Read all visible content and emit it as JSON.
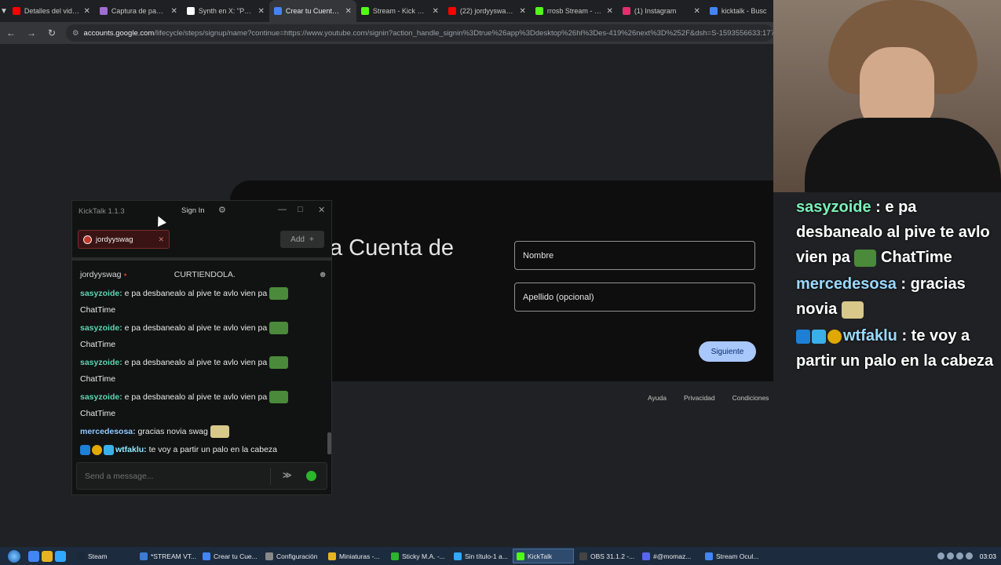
{
  "browser": {
    "tabs": [
      {
        "label": "Detalles del video",
        "color": "#ff0000",
        "active": false
      },
      {
        "label": "Captura de pantalla",
        "color": "#a06cd5",
        "active": false
      },
      {
        "label": "Synth en X: \"Podría",
        "color": "#ffffff",
        "active": false
      },
      {
        "label": "Crear tu Cuenta de",
        "color": "#4285f4",
        "active": true
      },
      {
        "label": "Stream - Kick Dash",
        "color": "#53fc18",
        "active": false
      },
      {
        "label": "(22) jordyyswag X",
        "color": "#ff0000",
        "active": false
      },
      {
        "label": "rrosb Stream - Wa",
        "color": "#53fc18",
        "active": false
      },
      {
        "label": "(1) Instagram",
        "color": "#e1306c",
        "active": false
      },
      {
        "label": "kicktalk - Busc",
        "color": "#4285f4",
        "active": false
      }
    ],
    "url_host": "accounts.google.com",
    "url_path": "/lifecycle/steps/signup/name?continue=https://www.youtube.com/signin?action_handle_signin%3Dtrue%26app%3Ddesktop%26hl%3Des-419%26next%3D%252F&dsh=S-1593556633:177044"
  },
  "signup": {
    "heading": "a Cuenta de",
    "first_name_label": "Nombre",
    "last_name_label": "Apellido (opcional)",
    "next_label": "Siguiente",
    "footer": [
      "Ayuda",
      "Privacidad",
      "Condiciones"
    ]
  },
  "kicktalk": {
    "title": "KickTalk 1.1.3",
    "sign_in": "Sign In",
    "channel_chip": "jordyyswag",
    "add_label": "Add",
    "channel_name": "jordyyswag",
    "stream_title": "CURTIENDOLA.",
    "messages": [
      {
        "user": "sasyzoide:",
        "text": " e pa desbanealo al pive te avlo vien pa",
        "emote": "pepe",
        "line2": "ChatTime",
        "color": "#5cd6b0"
      },
      {
        "user": "sasyzoide:",
        "text": " e pa desbanealo al pive te avlo vien pa",
        "emote": "pepe",
        "line2": "ChatTime",
        "color": "#5cd6b0"
      },
      {
        "user": "sasyzoide:",
        "text": " e pa desbanealo al pive te avlo vien pa",
        "emote": "pepe",
        "line2": "ChatTime",
        "color": "#5cd6b0"
      },
      {
        "user": "sasyzoide:",
        "text": " e pa desbanealo al pive te avlo vien pa",
        "emote": "pepe",
        "line2": "ChatTime",
        "color": "#5cd6b0"
      },
      {
        "user": "mercedesosa:",
        "text": " gracias novia swag",
        "emote": "robot",
        "line2": "",
        "color": "#8fc8ff"
      },
      {
        "user": "wtfaklu:",
        "text": " te voy a partir un palo en la cabeza",
        "emote": "",
        "line2": "",
        "color": "#8fe8ff"
      }
    ],
    "input_placeholder": "Send a message..."
  },
  "overlay": {
    "messages": [
      {
        "user": "sasyzoide",
        "text": " : e pa desbanealo al pive te avlo vien pa ",
        "tail": " ChatTime",
        "emote": "pepe"
      },
      {
        "user": "mercedesosa",
        "text": " : gracias novia ",
        "tail": "",
        "emote": "robot"
      },
      {
        "user": "wtfaklu",
        "text": " : te voy a partir un palo en la cabeza",
        "tail": "",
        "emote": ""
      }
    ]
  },
  "taskbar": {
    "items": [
      {
        "label": "Steam",
        "color": "#1b2838",
        "active": false
      },
      {
        "label": "*STREAM VT...",
        "color": "#3a7bd5",
        "active": false
      },
      {
        "label": "Crear tu Cue...",
        "color": "#4285f4",
        "active": false
      },
      {
        "label": "Configuración",
        "color": "#888888",
        "active": false
      },
      {
        "label": "Miniaturas -...",
        "color": "#e6b422",
        "active": false
      },
      {
        "label": "Sticky M.A. -...",
        "color": "#2bb52b",
        "active": false
      },
      {
        "label": "Sin título-1 a...",
        "color": "#31a8ff",
        "active": false
      },
      {
        "label": "KickTalk",
        "color": "#53fc18",
        "active": true
      },
      {
        "label": "OBS 31.1.2 -...",
        "color": "#444444",
        "active": false
      },
      {
        "label": "#@momaz...",
        "color": "#5865f2",
        "active": false
      },
      {
        "label": "Stream Ocul...",
        "color": "#4285f4",
        "active": false
      }
    ],
    "clock": "03:03"
  }
}
